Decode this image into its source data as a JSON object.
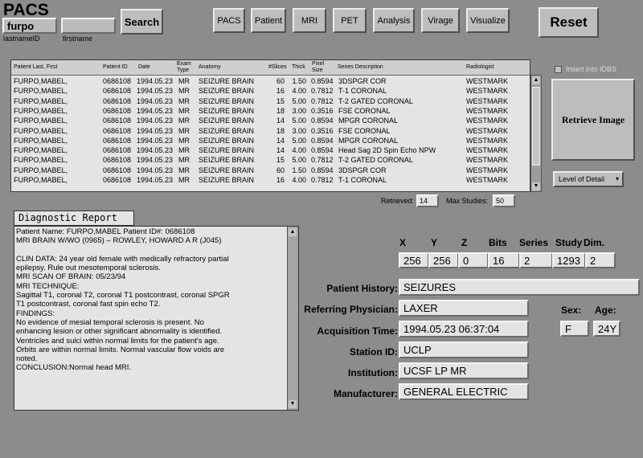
{
  "app": {
    "title": "PACS"
  },
  "search": {
    "lastname_value": "furpo",
    "firstname_value": "",
    "lastname_label": "lastnameID",
    "firstname_label": "firstname",
    "search_label": "Search"
  },
  "toolbar": {
    "buttons": [
      "PACS",
      "Patient",
      "MRI",
      "PET",
      "Analysis",
      "Virage",
      "Visualize"
    ],
    "reset_label": "Reset"
  },
  "table": {
    "headers": {
      "patient": "Patient Last, First",
      "id": "Patient ID",
      "date": "Date",
      "exam": "Exam Type",
      "anatomy": "Anatomy",
      "slices": "#Slices",
      "thick": "Thick",
      "pixel": "Pixel Size",
      "series": "Series Description",
      "radiologist": "Radiologist"
    },
    "rows": [
      [
        "FURPO,MABEL,",
        "0686108",
        "1994.05.23",
        "MR",
        "SEIZURE BRAIN",
        "60",
        "1.50",
        "0.8594",
        "3DSPGR COR",
        "WESTMARK"
      ],
      [
        "FURPO,MABEL,",
        "0686108",
        "1994.05.23",
        "MR",
        "SEIZURE BRAIN",
        "16",
        "4.00",
        "0.7812",
        "T-1 CORONAL",
        "WESTMARK"
      ],
      [
        "FURPO,MABEL,",
        "0686108",
        "1994.05.23",
        "MR",
        "SEIZURE BRAIN",
        "15",
        "5.00",
        "0.7812",
        "T-2 GATED CORONAL",
        "WESTMARK"
      ],
      [
        "FURPO,MABEL,",
        "0686108",
        "1994.05.23",
        "MR",
        "SEIZURE BRAIN",
        "18",
        "3.00",
        "0.3516",
        "FSE CORONAL",
        "WESTMARK"
      ],
      [
        "FURPO,MABEL,",
        "0686108",
        "1994.05.23",
        "MR",
        "SEIZURE BRAIN",
        "14",
        "5.00",
        "0.8594",
        "MPGR CORONAL",
        "WESTMARK"
      ],
      [
        "FURPO,MABEL,",
        "0686108",
        "1994.05.23",
        "MR",
        "SEIZURE BRAIN",
        "18",
        "3.00",
        "0.3516",
        "FSE CORONAL",
        "WESTMARK"
      ],
      [
        "FURPO,MABEL,",
        "0686108",
        "1994.05.23",
        "MR",
        "SEIZURE BRAIN",
        "14",
        "5.00",
        "0.8594",
        "MPGR CORONAL",
        "WESTMARK"
      ],
      [
        "FURPO,MABEL,",
        "0686108",
        "1994.05.23",
        "MR",
        "SEIZURE BRAIN",
        "14",
        "4.00",
        "0.8594",
        "Head Sag 2D Spin Echo NPW",
        "WESTMARK"
      ],
      [
        "FURPO,MABEL,",
        "0686108",
        "1994.05.23",
        "MR",
        "SEIZURE BRAIN",
        "15",
        "5.00",
        "0.7812",
        "T-2 GATED CORONAL",
        "WESTMARK"
      ],
      [
        "FURPO,MABEL,",
        "0686108",
        "1994.05.23",
        "MR",
        "SEIZURE BRAIN",
        "60",
        "1.50",
        "0.8594",
        "3DSPGR COR",
        "WESTMARK"
      ],
      [
        "FURPO,MABEL,",
        "0686108",
        "1994.05.23",
        "MR",
        "SEIZURE BRAIN",
        "16",
        "4.00",
        "0.7812",
        "T-1 CORONAL",
        "WESTMARK"
      ]
    ]
  },
  "side": {
    "insert_label": "Insert into IDBS",
    "retrieve_label": "Retrieve Image",
    "detail_label": "Level of Detail"
  },
  "counts": {
    "retrieved_label": "Retrieved:",
    "retrieved_value": "14",
    "max_label": "Max Studies:",
    "max_value": "50"
  },
  "report": {
    "title": "Diagnostic Report",
    "lines": [
      "Patient Name: FURPO,MABEL  Patient ID#: 0686108",
      "MRI BRAIN W/WO (0965)  – ROWLEY, HOWARD A    R (J045)",
      "",
      "CLIN  DATA:  24 year old female with medically refractory partial",
      "epilepsy.     Rule out mesotemporal sclerosis.",
      "MRI SCAN OF BRAIN:  05/23/94",
      "MRI TECHNIQUE:",
      "Sagittal T1, coronal T2, coronal T1 postcontrast, coronal SPGR",
      "T1 postcontrast, coronal fast spin echo T2.",
      "FINDINGS:",
      "No evidence of mesial temporal sclerosis is present.  No",
      "enhancing lesion or    other significant abnormality is identified.",
      "Ventricles and sulci within        normal limits for the patient's age.",
      "Orbits are within normal limits.  Normal  vascular flow voids are",
      "noted.",
      "CONCLUSION:Normal    head MRI."
    ]
  },
  "dims": {
    "headers": [
      "X",
      "Y",
      "Z",
      "Bits",
      "Series",
      "Study",
      "Dim."
    ],
    "values": [
      "256",
      "256",
      "0",
      "16",
      "2",
      "1293",
      "2"
    ]
  },
  "info": {
    "history_label": "Patient History:",
    "history_value": "SEIZURES",
    "physician_label": "Referring Physician:",
    "physician_value": "LAXER",
    "acq_label": "Acquisition Time:",
    "acq_value": "1994.05.23  06:37:04",
    "station_label": "Station ID:",
    "station_value": "UCLP",
    "institution_label": "Institution:",
    "institution_value": "UCSF LP MR",
    "manufacturer_label": "Manufacturer:",
    "manufacturer_value": "GENERAL ELECTRIC",
    "sex_label": "Sex:",
    "sex_value": "F",
    "age_label": "Age:",
    "age_value": "24Y"
  }
}
